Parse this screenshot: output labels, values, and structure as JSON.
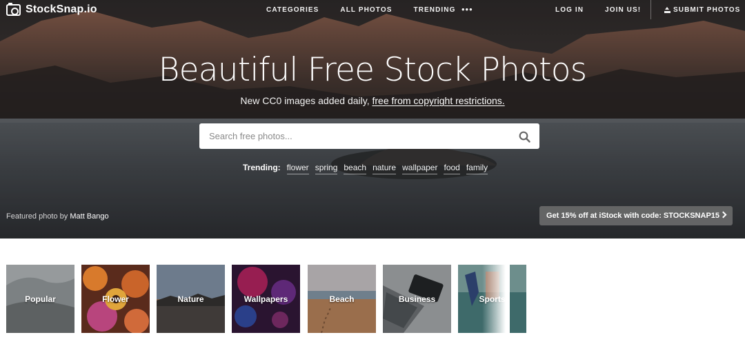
{
  "nav": {
    "logo": "StockSnap.io",
    "links": [
      "CATEGORIES",
      "ALL PHOTOS",
      "TRENDING"
    ],
    "more": "•••",
    "right_links": [
      "LOG IN",
      "JOIN US!"
    ],
    "submit": "SUBMIT PHOTOS",
    "icons": [
      "camera-logo-icon",
      "more-dots-icon",
      "upload-icon"
    ]
  },
  "hero": {
    "headline": "Beautiful Free Stock Photos",
    "subtitle_prefix": "New CC0 images added daily, ",
    "subtitle_link": "free from copyright restrictions.",
    "search_placeholder": "Search free photos...",
    "trending_label": "Trending:",
    "trending_tags": [
      "flower",
      "spring",
      "beach",
      "nature",
      "wallpaper",
      "food",
      "family"
    ],
    "credit_prefix": "Featured photo by",
    "credit_name": "Matt Bango",
    "promo": "Get 15% off at iStock with code: STOCKSNAP15"
  },
  "categories": [
    "Popular",
    "Flower",
    "Nature",
    "Wallpapers",
    "Beach",
    "Business",
    "Sports"
  ],
  "colors": {
    "white": "#ffffff",
    "promo_bg": "#6e6e6e"
  }
}
